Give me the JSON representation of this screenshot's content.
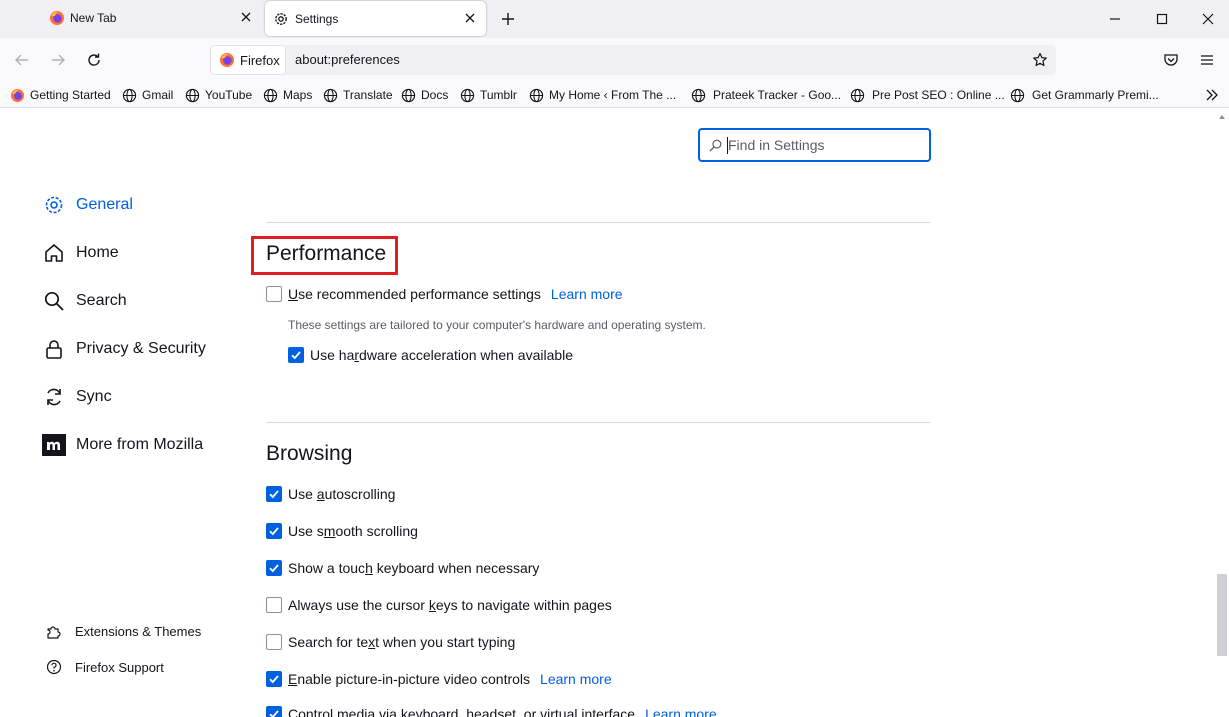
{
  "tabs": [
    {
      "label": "New Tab",
      "icon": "firefox-icon",
      "active": false
    },
    {
      "label": "Settings",
      "icon": "gear-icon",
      "active": true
    }
  ],
  "nav": {
    "identity_label": "Firefox",
    "url": "about:preferences"
  },
  "bookmarks": [
    {
      "label": "Getting Started",
      "icon": "firefox-icon"
    },
    {
      "label": "Gmail",
      "icon": "globe-icon"
    },
    {
      "label": "YouTube",
      "icon": "globe-icon"
    },
    {
      "label": "Maps",
      "icon": "globe-icon"
    },
    {
      "label": "Translate",
      "icon": "globe-icon"
    },
    {
      "label": "Docs",
      "icon": "globe-icon"
    },
    {
      "label": "Tumblr",
      "icon": "globe-icon"
    },
    {
      "label": "My Home ‹ From The ...",
      "icon": "globe-icon"
    },
    {
      "label": "Prateek Tracker - Goo...",
      "icon": "globe-icon"
    },
    {
      "label": "Pre Post SEO : Online ...",
      "icon": "globe-icon"
    },
    {
      "label": "Get Grammarly Premi...",
      "icon": "globe-icon"
    }
  ],
  "search": {
    "placeholder": "Find in Settings"
  },
  "sidebar": {
    "items": [
      {
        "label": "General",
        "icon": "gear-icon",
        "selected": true
      },
      {
        "label": "Home",
        "icon": "home-icon"
      },
      {
        "label": "Search",
        "icon": "search-icon"
      },
      {
        "label": "Privacy & Security",
        "icon": "lock-icon"
      },
      {
        "label": "Sync",
        "icon": "sync-icon"
      },
      {
        "label": "More from Mozilla",
        "icon": "mozilla-icon"
      }
    ],
    "footer": [
      {
        "label": "Extensions & Themes",
        "icon": "puzzle-icon"
      },
      {
        "label": "Firefox Support",
        "icon": "help-icon"
      }
    ]
  },
  "performance": {
    "title": "Performance",
    "recommended": {
      "pre": "",
      "u": "U",
      "post": "se recommended performance settings",
      "checked": false,
      "link": "Learn more"
    },
    "description": "These settings are tailored to your computer's hardware and operating system.",
    "hardware": {
      "pre": "Use ha",
      "u": "r",
      "post": "dware acceleration when available",
      "checked": true
    }
  },
  "browsing": {
    "title": "Browsing",
    "items": [
      {
        "pre": "Use ",
        "u": "a",
        "post": "utoscrolling",
        "checked": true
      },
      {
        "pre": "Use s",
        "u": "m",
        "post": "ooth scrolling",
        "checked": true
      },
      {
        "pre": "Show a touc",
        "u": "h",
        "post": " keyboard when necessary",
        "checked": true
      },
      {
        "pre": "Always use the cursor ",
        "u": "k",
        "post": "eys to navigate within pages",
        "checked": false
      },
      {
        "pre": "Search for te",
        "u": "x",
        "post": "t when you start typing",
        "checked": false
      },
      {
        "pre": "",
        "u": "E",
        "post": "nable picture-in-picture video controls",
        "checked": true,
        "link": "Learn more"
      },
      {
        "pre": "Control media via keyboard, headset, or virtual interface",
        "u": "",
        "post": "",
        "checked": true,
        "link": "Learn more"
      }
    ]
  },
  "colors": {
    "accent": "#0061e0",
    "highlight_box": "#e02020"
  }
}
